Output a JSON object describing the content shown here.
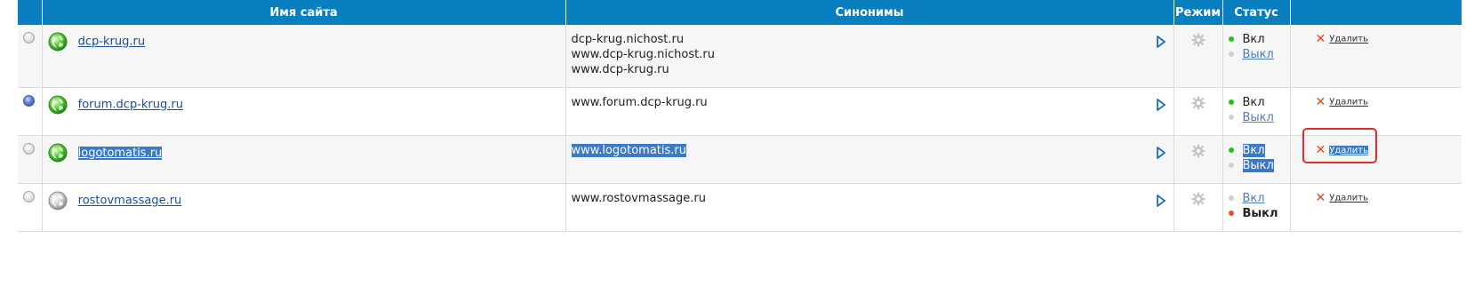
{
  "table": {
    "headers": {
      "select": "",
      "site_name": "Имя сайта",
      "synonyms": "Синонимы",
      "mode": "Режим",
      "status": "Статус",
      "actions": ""
    },
    "rows": [
      {
        "site": "dcp-krug.ru",
        "selected": false,
        "synonyms": [
          "dcp-krug.nichost.ru",
          "www.dcp-krug.nichost.ru",
          "www.dcp-krug.ru"
        ],
        "status_on": "Вкл",
        "status_off": "Выкл",
        "delete_label": "Удалить"
      },
      {
        "site": "forum.dcp-krug.ru",
        "selected": true,
        "synonyms": [
          "www.forum.dcp-krug.ru"
        ],
        "status_on": "Вкл",
        "status_off": "Выкл",
        "delete_label": "Удалить"
      },
      {
        "site": "logotomatis.ru",
        "selected": false,
        "synonyms": [
          "www.logotomatis.ru"
        ],
        "status_on": "Вкл",
        "status_off": "Выкл",
        "delete_label": "Удалить"
      },
      {
        "site": "rostovmassage.ru",
        "selected": false,
        "synonyms": [
          "www.rostovmassage.ru"
        ],
        "status_on": "Вкл",
        "status_off": "Выкл",
        "delete_label": "Удалить"
      }
    ]
  },
  "colors": {
    "header_bg": "#0a7fc0",
    "link": "#1a4fa0",
    "highlight": "#3b79c9",
    "status_on": "#22c022",
    "status_off_active": "#e85030",
    "delete_icon": "#e04a1a",
    "annotation_box": "#e52b2b"
  },
  "icons": {
    "select": "radio-button-icon",
    "site": "globe-icon",
    "synonyms_expand": "play-arrow-icon",
    "mode": "gear-icon",
    "status": "dot-icon",
    "delete": "cross-icon"
  }
}
